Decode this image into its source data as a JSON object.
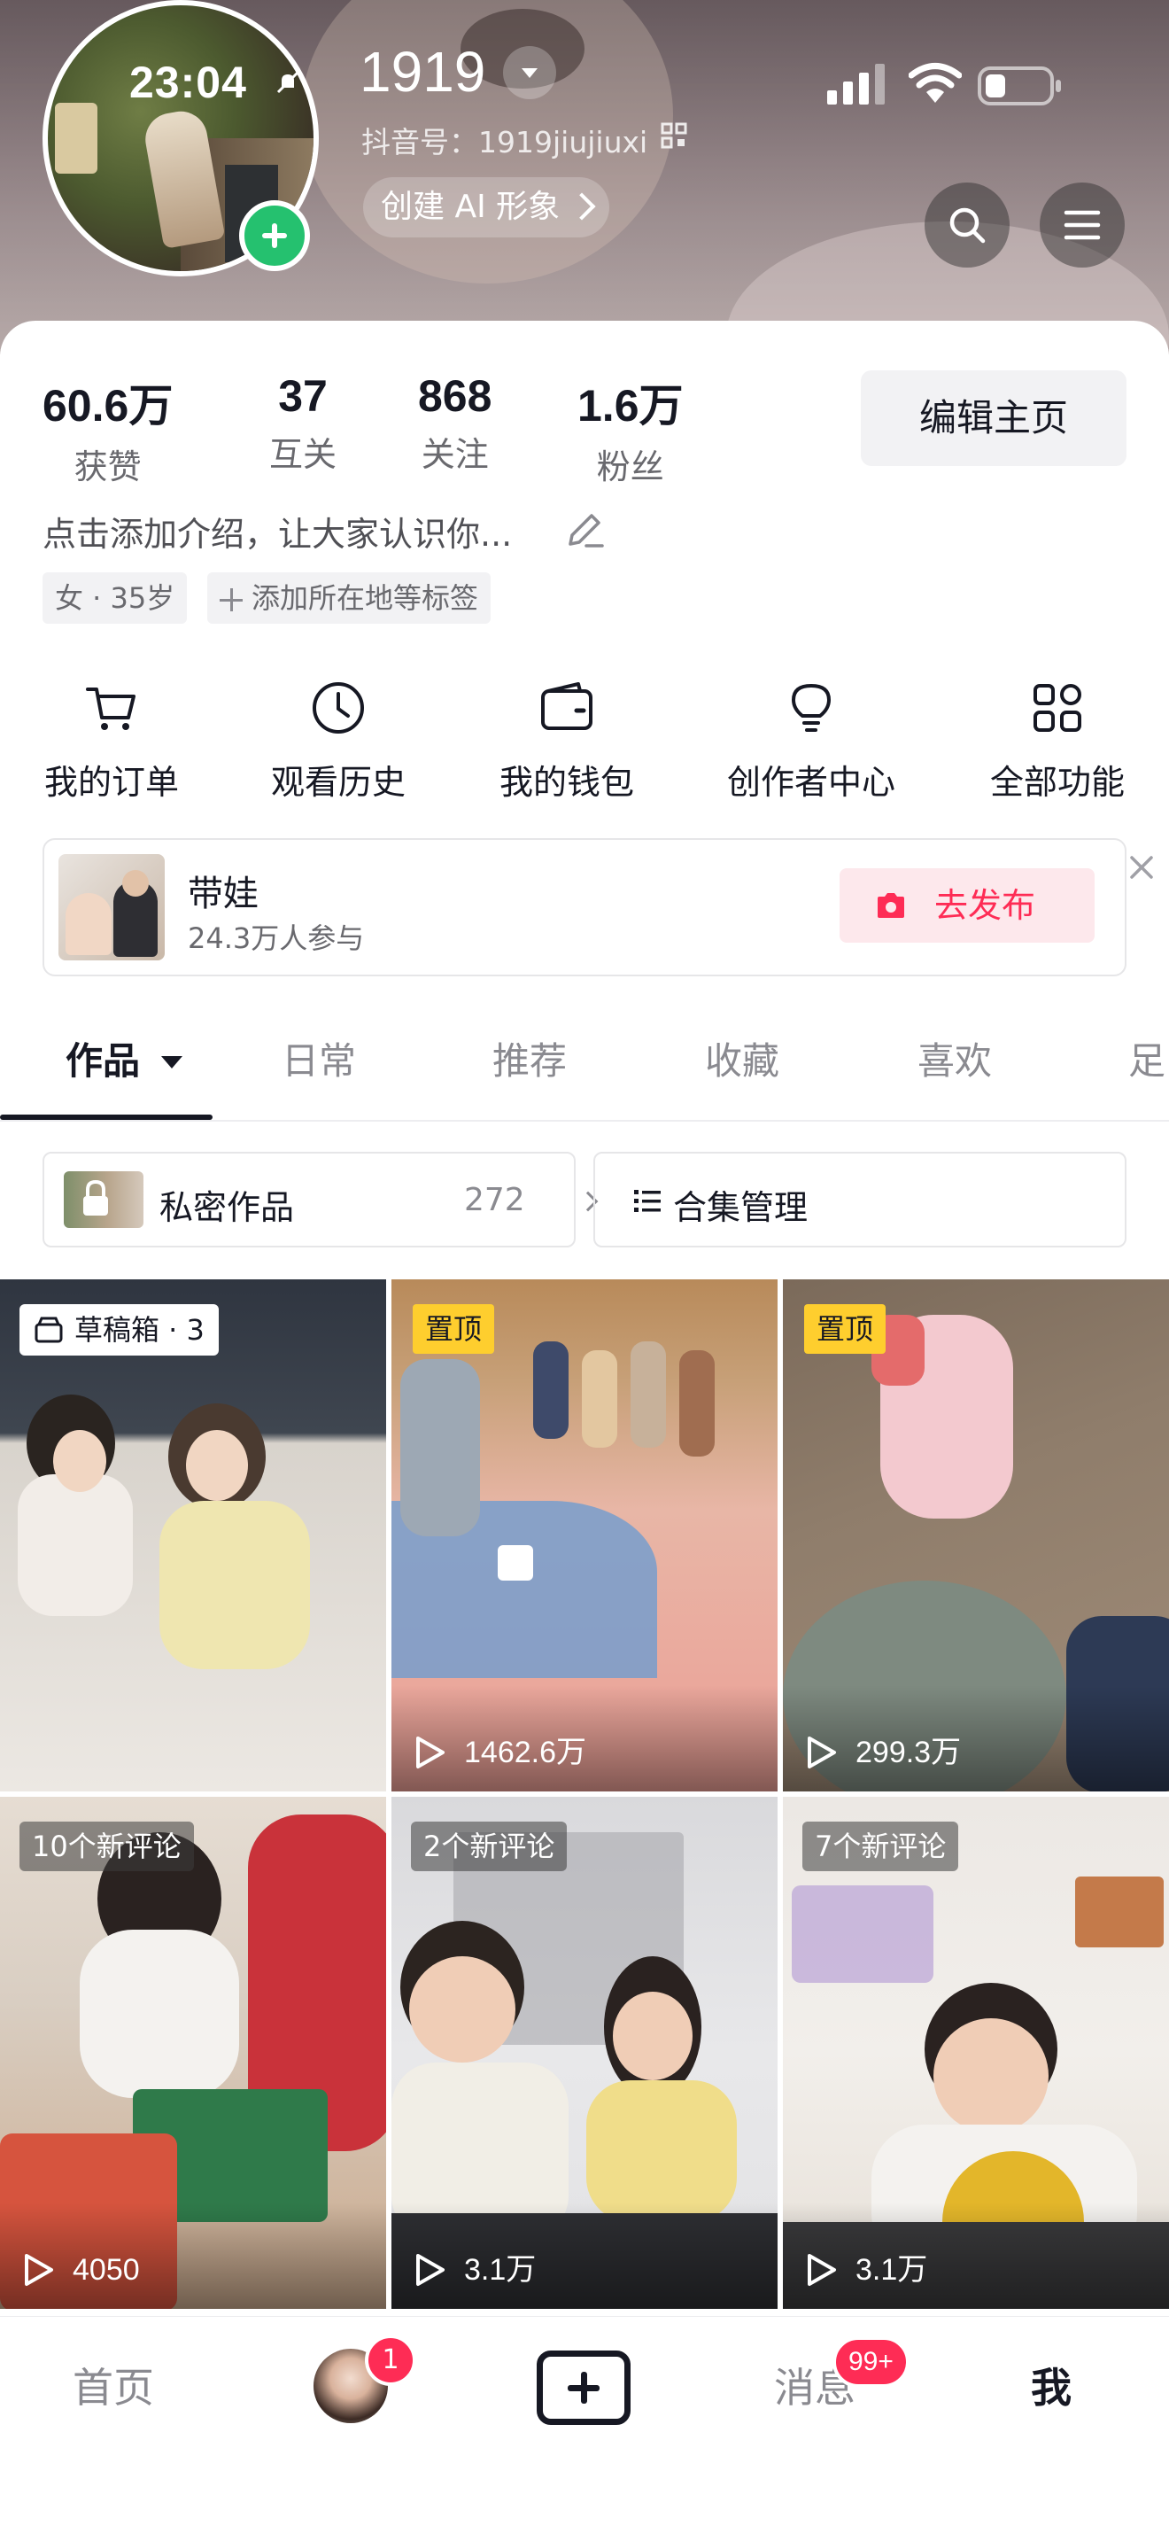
{
  "status_bar": {
    "time": "23:04"
  },
  "profile": {
    "nickname": "1919",
    "douyin_id": "抖音号：1919jiujiuxi",
    "ai_button": "创建 AI 形象",
    "bio": "点击添加介绍，让大家认识你...",
    "tags": [
      "女 · 35岁",
      "添加所在地等标签"
    ],
    "edit_button": "编辑主页"
  },
  "stats": [
    {
      "value": "60.6万",
      "label": "获赞"
    },
    {
      "value": "37",
      "label": "互关"
    },
    {
      "value": "868",
      "label": "关注"
    },
    {
      "value": "1.6万",
      "label": "粉丝"
    }
  ],
  "quick_actions": [
    {
      "label": "我的订单",
      "icon": "cart-icon"
    },
    {
      "label": "观看历史",
      "icon": "clock-icon"
    },
    {
      "label": "我的钱包",
      "icon": "wallet-icon"
    },
    {
      "label": "创作者中心",
      "icon": "lightbulb-icon"
    },
    {
      "label": "全部功能",
      "icon": "grid-icon"
    }
  ],
  "topic": {
    "title": "带娃",
    "participants": "24.3万人参与",
    "button": "去发布"
  },
  "tabs": [
    "作品",
    "日常",
    "推荐",
    "收藏",
    "喜欢",
    "足"
  ],
  "subbar": {
    "private_label": "私密作品",
    "private_count": "272",
    "collection_label": "合集管理"
  },
  "videos": [
    {
      "badge": "草稿箱 · 3",
      "badge_type": "draft",
      "plays": ""
    },
    {
      "badge": "置顶",
      "badge_type": "pinned",
      "plays": "1462.6万"
    },
    {
      "badge": "置顶",
      "badge_type": "pinned",
      "plays": "299.3万"
    },
    {
      "badge": "10个新评论",
      "badge_type": "comments",
      "plays": "4050"
    },
    {
      "badge": "2个新评论",
      "badge_type": "comments",
      "plays": "3.1万"
    },
    {
      "badge": "7个新评论",
      "badge_type": "comments",
      "plays": "3.1万"
    }
  ],
  "bottom_nav": {
    "home": "首页",
    "friends_badge": "1",
    "messages": "消息",
    "messages_badge": "99+",
    "me": "我"
  },
  "colors": {
    "accent": "#fe2c55",
    "pin": "#fece2e",
    "add_green": "#25c16f"
  }
}
